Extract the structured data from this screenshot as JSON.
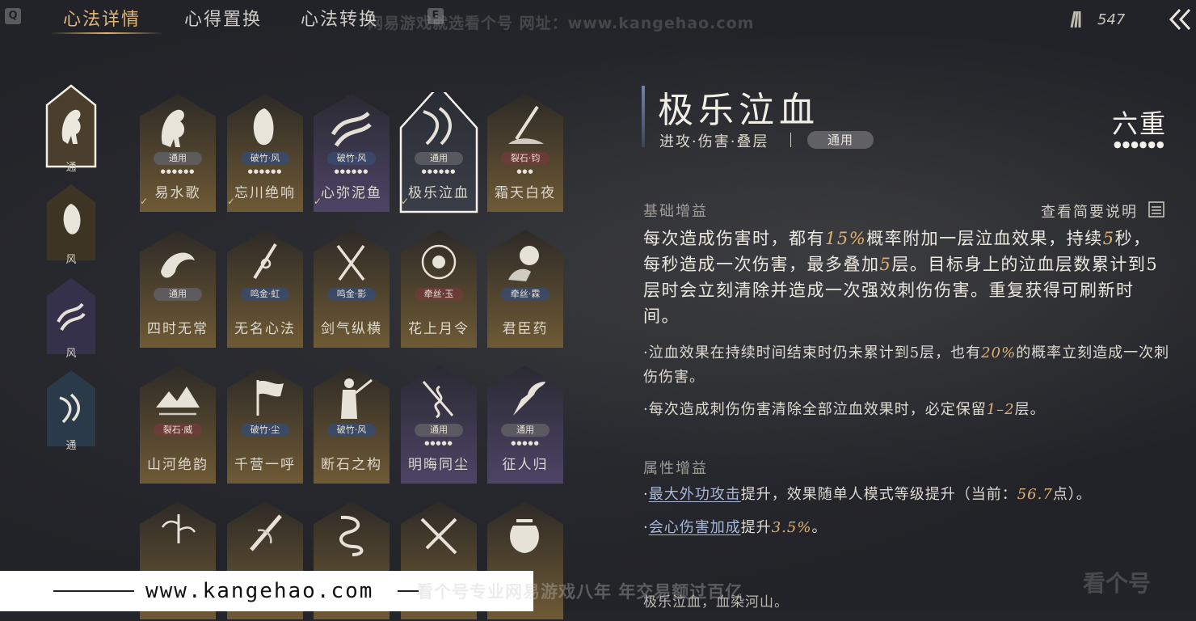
{
  "keys": {
    "left": "Q",
    "right": "E"
  },
  "tabs": [
    {
      "label": "心法详情",
      "active": true
    },
    {
      "label": "心得置换",
      "active": false
    },
    {
      "label": "心法转换",
      "active": false
    }
  ],
  "currency": {
    "icon": "arrows-bundle-icon",
    "amount": "547"
  },
  "back_icon": "double-chevron-left-icon",
  "categories": [
    {
      "label": "通",
      "icon": "horse-icon",
      "selected": true
    },
    {
      "label": "风",
      "icon": "mask-icon",
      "selected": false
    },
    {
      "label": "风",
      "icon": "fish-icon",
      "selected": false
    },
    {
      "label": "通",
      "icon": "blade-icon",
      "selected": false
    }
  ],
  "cards": [
    {
      "name": "易水歌",
      "tag": "通用",
      "tag_color": "gray",
      "dots": "●●●●●●",
      "theme": "gold",
      "checked": true,
      "icon": "horse-icon"
    },
    {
      "name": "忘川绝响",
      "tag": "破竹·风",
      "tag_color": "blue",
      "dots": "●●●●●●",
      "theme": "gold",
      "checked": true,
      "icon": "mask-icon"
    },
    {
      "name": "心弥泥鱼",
      "tag": "破竹·风",
      "tag_color": "blue",
      "dots": "●●●●●●",
      "theme": "purple",
      "checked": true,
      "icon": "fish-icon"
    },
    {
      "name": "极乐泣血",
      "tag": "通用",
      "tag_color": "gray",
      "dots": "●●●●●●",
      "theme": "selected",
      "checked": true,
      "icon": "blade-icon"
    },
    {
      "name": "霜天白夜",
      "tag": "裂石·钧",
      "tag_color": "red",
      "dots": "●●●",
      "theme": "gold",
      "checked": false,
      "icon": "spear-icon"
    },
    {
      "name": "四时无常",
      "tag": "通用",
      "tag_color": "gray",
      "dots": "",
      "theme": "gold",
      "checked": false,
      "icon": "crane-icon"
    },
    {
      "name": "无名心法",
      "tag": "鸣金·虹",
      "tag_color": "blue",
      "dots": "",
      "theme": "gold",
      "checked": false,
      "icon": "sword-icon"
    },
    {
      "name": "剑气纵横",
      "tag": "鸣金·影",
      "tag_color": "blue",
      "dots": "",
      "theme": "gold",
      "checked": false,
      "icon": "swords-icon"
    },
    {
      "name": "花上月令",
      "tag": "牵丝·玉",
      "tag_color": "red",
      "dots": "",
      "theme": "gold",
      "checked": false,
      "icon": "flower-icon"
    },
    {
      "name": "君臣药",
      "tag": "牵丝·霖",
      "tag_color": "blue",
      "dots": "",
      "theme": "gold",
      "checked": false,
      "icon": "gourd-icon"
    },
    {
      "name": "山河绝韵",
      "tag": "裂石·威",
      "tag_color": "red",
      "dots": "",
      "theme": "gold",
      "checked": false,
      "icon": "mountain-icon"
    },
    {
      "name": "千营一呼",
      "tag": "破竹·尘",
      "tag_color": "blue",
      "dots": "",
      "theme": "gold",
      "checked": false,
      "icon": "flag-icon"
    },
    {
      "name": "断石之构",
      "tag": "破竹·风",
      "tag_color": "blue",
      "dots": "",
      "theme": "gold",
      "checked": false,
      "icon": "warrior-icon"
    },
    {
      "name": "明晦同尘",
      "tag": "通用",
      "tag_color": "gray",
      "dots": "●●●●●",
      "theme": "purple",
      "checked": false,
      "icon": "snake-icon"
    },
    {
      "name": "征人归",
      "tag": "通用",
      "tag_color": "gray",
      "dots": "●●●●●",
      "theme": "purple",
      "checked": false,
      "icon": "bird-icon"
    },
    {
      "name": "",
      "tag": "",
      "tag_color": "gray",
      "dots": "",
      "theme": "gold",
      "checked": false,
      "icon": "bamboo-icon"
    },
    {
      "name": "",
      "tag": "",
      "tag_color": "gray",
      "dots": "",
      "theme": "gold",
      "checked": false,
      "icon": "brush-icon"
    },
    {
      "name": "",
      "tag": "",
      "tag_color": "gray",
      "dots": "",
      "theme": "gold",
      "checked": false,
      "icon": "dragon-icon"
    },
    {
      "name": "",
      "tag": "",
      "tag_color": "gray",
      "dots": "",
      "theme": "gold",
      "checked": false,
      "icon": "crossed-swords-icon"
    },
    {
      "name": "",
      "tag": "",
      "tag_color": "gray",
      "dots": "",
      "theme": "gold",
      "checked": false,
      "icon": "jar-icon"
    }
  ],
  "detail": {
    "title": "极乐泣血",
    "subtitle": "进攻·伤害·叠层",
    "badge": "通用",
    "level": "六重",
    "level_dots": "●●●●●●",
    "base_section": "基础增益",
    "view_brief": "查看简要说明",
    "main_desc": {
      "p1": "每次造成伤害时，都有",
      "h1": "15%",
      "p2": "概率附加一层泣血效果，持续",
      "h2": "5",
      "p3": "秒，每秒造成一次伤害，最多叠加",
      "h3": "5",
      "p4": "层。目标身上的泣血层数累计到5层时会立刻清除并造成一次强效刺伤伤害。重复获得可刷新时间。"
    },
    "note1": {
      "p1": "·泣血效果在持续时间结束时仍未累计到5层，也有",
      "h1": "20%",
      "p2": "的概率立刻造成一次刺伤伤害。"
    },
    "note2": {
      "p1": "·每次造成刺伤伤害清除全部泣血效果时，必定保留",
      "h1": "1–2",
      "p2": "层。"
    },
    "attr_section": "属性增益",
    "attr1": {
      "bullet": "·",
      "link": "最大外功攻击",
      "p1": "提升，效果随单人模式等级提升（当前：",
      "h1": "56.7",
      "p2": "点）。"
    },
    "attr2": {
      "bullet": "·",
      "link": "会心伤害加成",
      "p1": "提升",
      "h1": "3.5%",
      "p2": "。"
    },
    "footer": "极乐泣血，血染河山。"
  },
  "watermark": {
    "top": "网易游戏就选看个号  网址：www.kangehao.com",
    "url": "www.kangehao.com",
    "tagline": "看个号专业网易游戏八年  年交易额过百亿",
    "logo": "看个号"
  },
  "colors": {
    "accent": "#e0b679",
    "highlight": "#e2b06e",
    "link": "#a9b8d8"
  }
}
